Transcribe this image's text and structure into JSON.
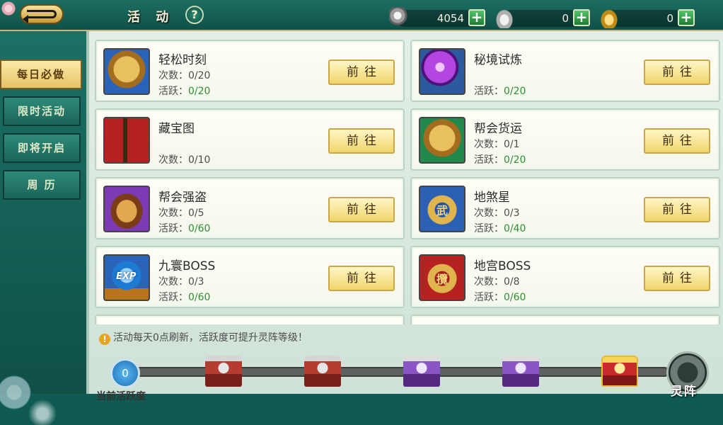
{
  "header": {
    "title": "活 动",
    "help": "?",
    "currencies": [
      {
        "icon": "silver-coin-icon",
        "value": "4054"
      },
      {
        "icon": "silver-ingot-icon",
        "value": "0"
      },
      {
        "icon": "gold-ingot-icon",
        "value": "0"
      }
    ],
    "plus": "+"
  },
  "tabs": [
    {
      "label": "每日必做",
      "active": true
    },
    {
      "label": "限时活动",
      "active": false
    },
    {
      "label": "即将开启",
      "active": false
    },
    {
      "label": "周 历",
      "active": false
    }
  ],
  "activities": [
    {
      "name": "轻松时刻",
      "count": "0/20",
      "active": "0/20",
      "icon": "golden-fox-icon"
    },
    {
      "name": "秘境试炼",
      "count": "",
      "active": "0/20",
      "icon": "purple-orb-icon"
    },
    {
      "name": "藏宝图",
      "count": "0/10",
      "active": "",
      "icon": "treasure-map-icon"
    },
    {
      "name": "帮会货运",
      "count": "0/1",
      "active": "0/20",
      "icon": "golden-fox-icon"
    },
    {
      "name": "帮会强盗",
      "count": "0/5",
      "active": "0/60",
      "icon": "loot-bag-icon"
    },
    {
      "name": "地煞星",
      "count": "0/3",
      "active": "0/40",
      "icon": "martial-plaque-icon",
      "glyph": "武"
    },
    {
      "name": "九寰BOSS",
      "count": "0/3",
      "active": "0/60",
      "icon": "exp-orb-icon",
      "glyph": "EXP"
    },
    {
      "name": "地宫BOSS",
      "count": "0/8",
      "active": "0/60",
      "icon": "red-plaque-icon",
      "glyph": "攬"
    }
  ],
  "labels": {
    "count": "次数：",
    "active": "活跃：",
    "go": "前往"
  },
  "footer": {
    "notice": "活动每天0点刷新，活跃度可提升灵阵等级！",
    "notice_icon": "!",
    "points": "0",
    "points_label": "当前活跃度",
    "progress": 0,
    "lingzhen": "灵阵"
  }
}
